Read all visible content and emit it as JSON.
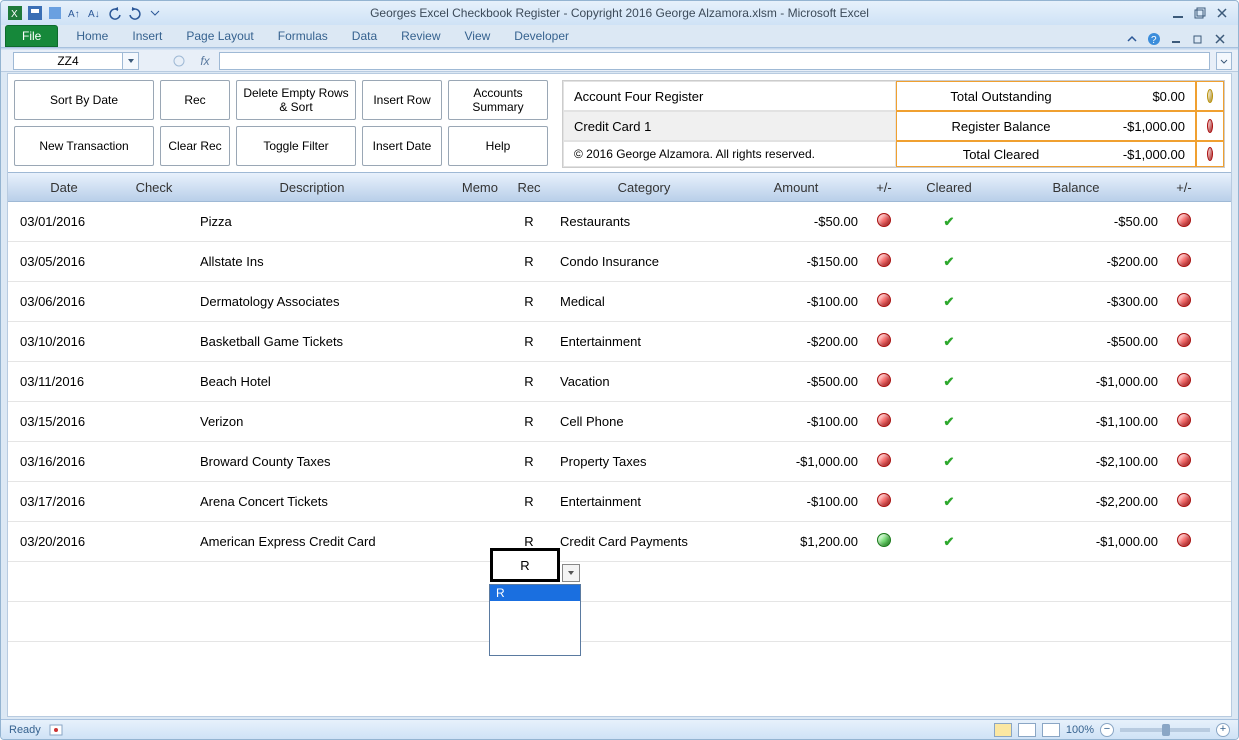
{
  "titlebar": {
    "title": "Georges Excel Checkbook Register - Copyright 2016 George Alzamora.xlsm  -  Microsoft Excel"
  },
  "ribbon": {
    "file": "File",
    "tabs": [
      "Home",
      "Insert",
      "Page Layout",
      "Formulas",
      "Data",
      "Review",
      "View",
      "Developer"
    ]
  },
  "namebox": {
    "value": "ZZ4"
  },
  "toolbuttons": {
    "sort_by_date": "Sort By Date",
    "rec": "Rec",
    "delete_empty": "Delete Empty Rows & Sort",
    "insert_row": "Insert Row",
    "accounts_summary": "Accounts Summary",
    "new_transaction": "New Transaction",
    "clear_rec": "Clear Rec",
    "toggle_filter": "Toggle Filter",
    "insert_date": "Insert Date",
    "help": "Help"
  },
  "info": {
    "register_label": "Account Four Register",
    "account_name": "Credit Card 1",
    "copyright": "© 2016 George Alzamora.  All rights reserved.",
    "total_outstanding_label": "Total Outstanding",
    "total_outstanding_value": "$0.00",
    "register_balance_label": "Register Balance",
    "register_balance_value": "-$1,000.00",
    "total_cleared_label": "Total Cleared",
    "total_cleared_value": "-$1,000.00"
  },
  "columns": {
    "date": "Date",
    "check": "Check",
    "description": "Description",
    "memo": "Memo",
    "rec": "Rec",
    "category": "Category",
    "amount": "Amount",
    "pm1": "+/-",
    "cleared": "Cleared",
    "balance": "Balance",
    "pm2": "+/-"
  },
  "rows": [
    {
      "date": "03/01/2016",
      "check": "",
      "description": "Pizza",
      "memo": "",
      "rec": "R",
      "category": "Restaurants",
      "amount": "-$50.00",
      "pm": "red",
      "cleared": true,
      "balance": "-$50.00",
      "pm2": "red"
    },
    {
      "date": "03/05/2016",
      "check": "",
      "description": "Allstate Ins",
      "memo": "",
      "rec": "R",
      "category": "Condo Insurance",
      "amount": "-$150.00",
      "pm": "red",
      "cleared": true,
      "balance": "-$200.00",
      "pm2": "red"
    },
    {
      "date": "03/06/2016",
      "check": "",
      "description": "Dermatology Associates",
      "memo": "",
      "rec": "R",
      "category": "Medical",
      "amount": "-$100.00",
      "pm": "red",
      "cleared": true,
      "balance": "-$300.00",
      "pm2": "red"
    },
    {
      "date": "03/10/2016",
      "check": "",
      "description": "Basketball Game Tickets",
      "memo": "",
      "rec": "R",
      "category": "Entertainment",
      "amount": "-$200.00",
      "pm": "red",
      "cleared": true,
      "balance": "-$500.00",
      "pm2": "red"
    },
    {
      "date": "03/11/2016",
      "check": "",
      "description": "Beach Hotel",
      "memo": "",
      "rec": "R",
      "category": "Vacation",
      "amount": "-$500.00",
      "pm": "red",
      "cleared": true,
      "balance": "-$1,000.00",
      "pm2": "red"
    },
    {
      "date": "03/15/2016",
      "check": "",
      "description": "Verizon",
      "memo": "",
      "rec": "R",
      "category": "Cell Phone",
      "amount": "-$100.00",
      "pm": "red",
      "cleared": true,
      "balance": "-$1,100.00",
      "pm2": "red"
    },
    {
      "date": "03/16/2016",
      "check": "",
      "description": "Broward County Taxes",
      "memo": "",
      "rec": "R",
      "category": "Property Taxes",
      "amount": "-$1,000.00",
      "pm": "red",
      "cleared": true,
      "balance": "-$2,100.00",
      "pm2": "red"
    },
    {
      "date": "03/17/2016",
      "check": "",
      "description": "Arena Concert Tickets",
      "memo": "",
      "rec": "R",
      "category": "Entertainment",
      "amount": "-$100.00",
      "pm": "red",
      "cleared": true,
      "balance": "-$2,200.00",
      "pm2": "red"
    },
    {
      "date": "03/20/2016",
      "check": "",
      "description": "American Express Credit Card",
      "memo": "",
      "rec": "R",
      "category": "Credit Card Payments",
      "amount": "$1,200.00",
      "pm": "green",
      "cleared": true,
      "balance": "-$1,000.00",
      "pm2": "red"
    }
  ],
  "dropdown": {
    "option": "R"
  },
  "statusbar": {
    "ready": "Ready",
    "zoom": "100%"
  }
}
